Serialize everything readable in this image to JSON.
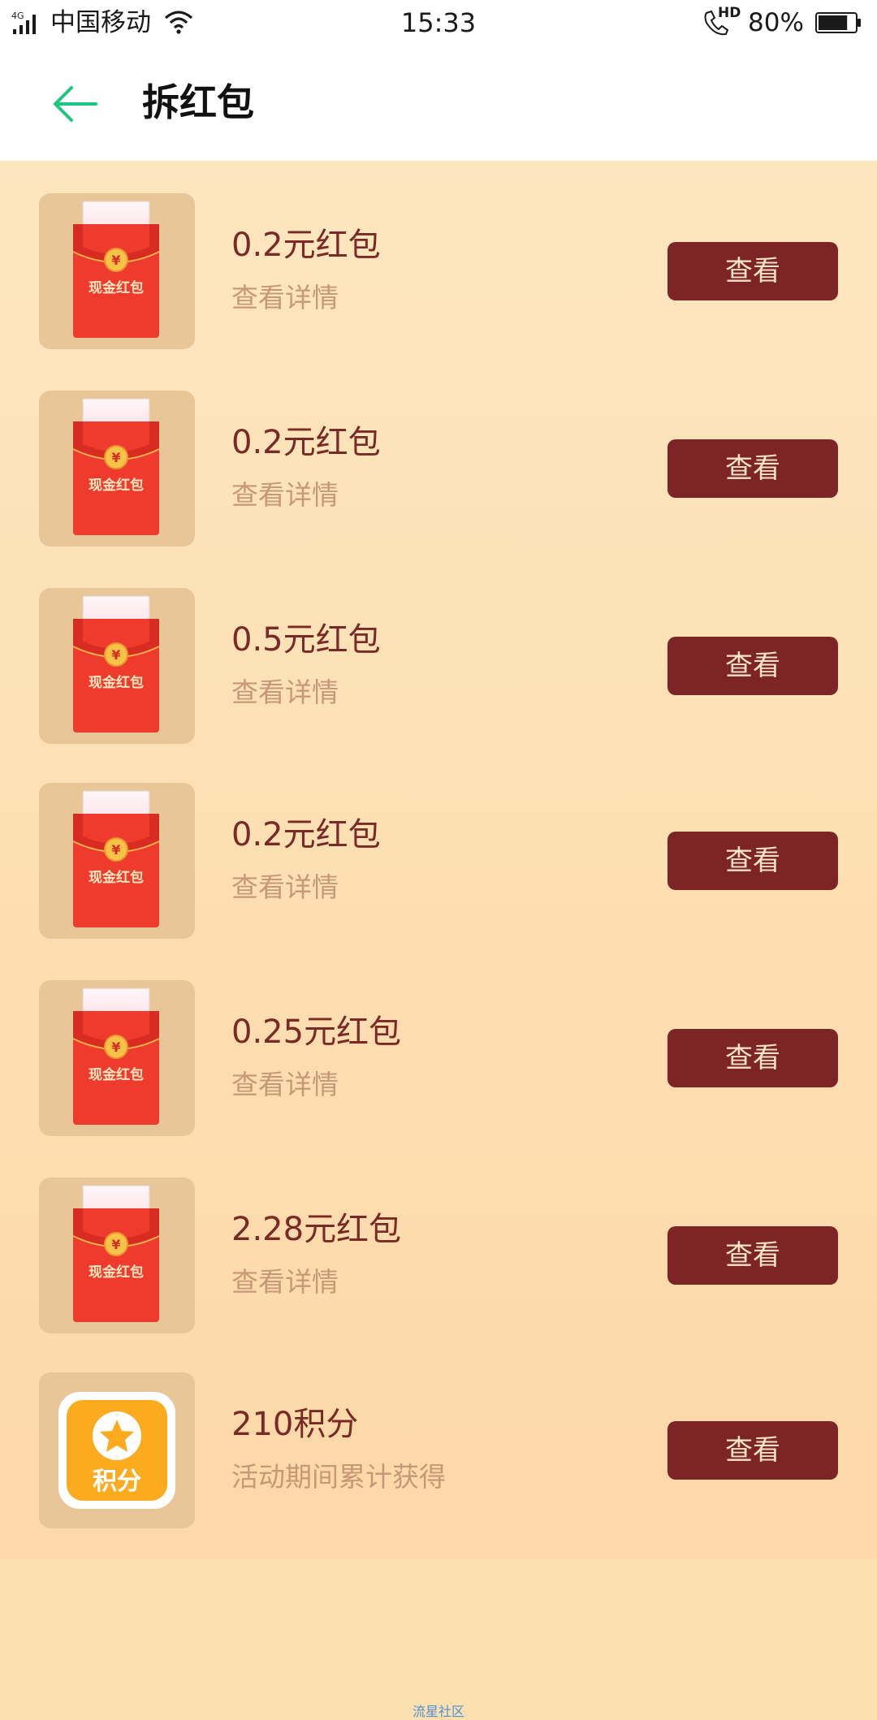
{
  "status_bar": {
    "network": "4G",
    "carrier": "中国移动",
    "time": "15:33",
    "hd": "HD",
    "battery": "80%",
    "battery_level": 0.8
  },
  "header": {
    "title": "拆红包",
    "accent_color": "#1fc47f"
  },
  "envelope_label": "现金红包",
  "envelope_symbol": "¥",
  "items": [
    {
      "title": "0.2元红包",
      "subtitle": "查看详情",
      "button": "查看",
      "icon": "red-envelope-icon"
    },
    {
      "title": "0.2元红包",
      "subtitle": "查看详情",
      "button": "查看",
      "icon": "red-envelope-icon"
    },
    {
      "title": "0.5元红包",
      "subtitle": "查看详情",
      "button": "查看",
      "icon": "red-envelope-icon"
    },
    {
      "title": "0.2元红包",
      "subtitle": "查看详情",
      "button": "查看",
      "icon": "red-envelope-icon"
    },
    {
      "title": "0.25元红包",
      "subtitle": "查看详情",
      "button": "查看",
      "icon": "red-envelope-icon"
    },
    {
      "title": "2.28元红包",
      "subtitle": "查看详情",
      "button": "查看",
      "icon": "red-envelope-icon"
    },
    {
      "title": "210积分",
      "subtitle": "活动期间累计获得",
      "button": "查看",
      "icon": "points-icon",
      "icon_label": "积分"
    }
  ],
  "watermark": "流星社区",
  "colors": {
    "button_bg": "#7d2427",
    "button_text": "#fbe4c8",
    "title_text": "#7a2a24",
    "subtitle_text": "#c79878",
    "page_bg": "#fde0b0"
  }
}
